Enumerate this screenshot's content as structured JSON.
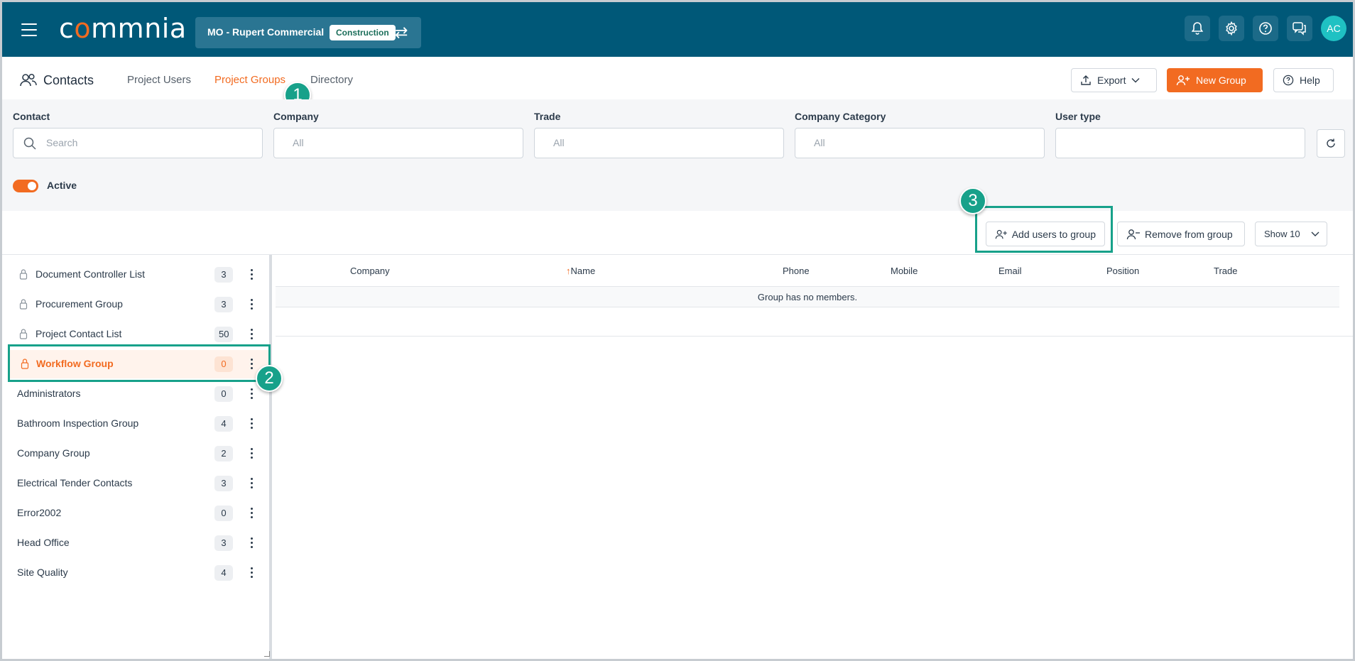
{
  "header": {
    "logo_left": "c",
    "logo_accent": "o",
    "logo_rest": "mmnia",
    "project_name": "MO - Rupert Commercial",
    "project_badge": "Construction",
    "avatar_initials": "AC"
  },
  "page": {
    "title": "Contacts",
    "tabs": [
      {
        "label": "Project Users",
        "active": false
      },
      {
        "label": "Project Groups",
        "active": true
      },
      {
        "label": "Directory",
        "active": false
      }
    ],
    "export_label": "Export",
    "new_group_label": "New Group",
    "help_label": "Help"
  },
  "filters": {
    "contact_label": "Contact",
    "contact_placeholder": "Search",
    "company_label": "Company",
    "company_value": "All",
    "trade_label": "Trade",
    "trade_value": "All",
    "category_label": "Company Category",
    "category_value": "All",
    "user_type_label": "User type",
    "user_type_value": "",
    "active_label": "Active",
    "active_on": true
  },
  "actions": {
    "add_users_label": "Add users to group",
    "remove_label": "Remove from group",
    "show_label": "Show 10"
  },
  "steps": [
    "1",
    "2",
    "3"
  ],
  "groups": [
    {
      "name": "Document Controller List",
      "count": "3",
      "locked": true
    },
    {
      "name": "Procurement Group",
      "count": "3",
      "locked": true
    },
    {
      "name": "Project Contact List",
      "count": "50",
      "locked": true
    },
    {
      "name": "Workflow Group",
      "count": "0",
      "locked": true,
      "selected": true
    },
    {
      "name": "Administrators",
      "count": "0",
      "locked": false
    },
    {
      "name": "Bathroom Inspection Group",
      "count": "4",
      "locked": false
    },
    {
      "name": "Company Group",
      "count": "2",
      "locked": false
    },
    {
      "name": "Electrical Tender Contacts",
      "count": "3",
      "locked": false
    },
    {
      "name": "Error2002",
      "count": "0",
      "locked": false
    },
    {
      "name": "Head Office",
      "count": "3",
      "locked": false
    },
    {
      "name": "Site Quality",
      "count": "4",
      "locked": false
    }
  ],
  "table": {
    "columns": [
      "Company",
      "Name",
      "Phone",
      "Mobile",
      "Email",
      "Position",
      "Trade"
    ],
    "sort_indicator": "↑",
    "empty_message": "Group has no members."
  },
  "colors": {
    "topbar": "#005878",
    "accent": "#f26b21",
    "highlight": "#17a18a"
  }
}
